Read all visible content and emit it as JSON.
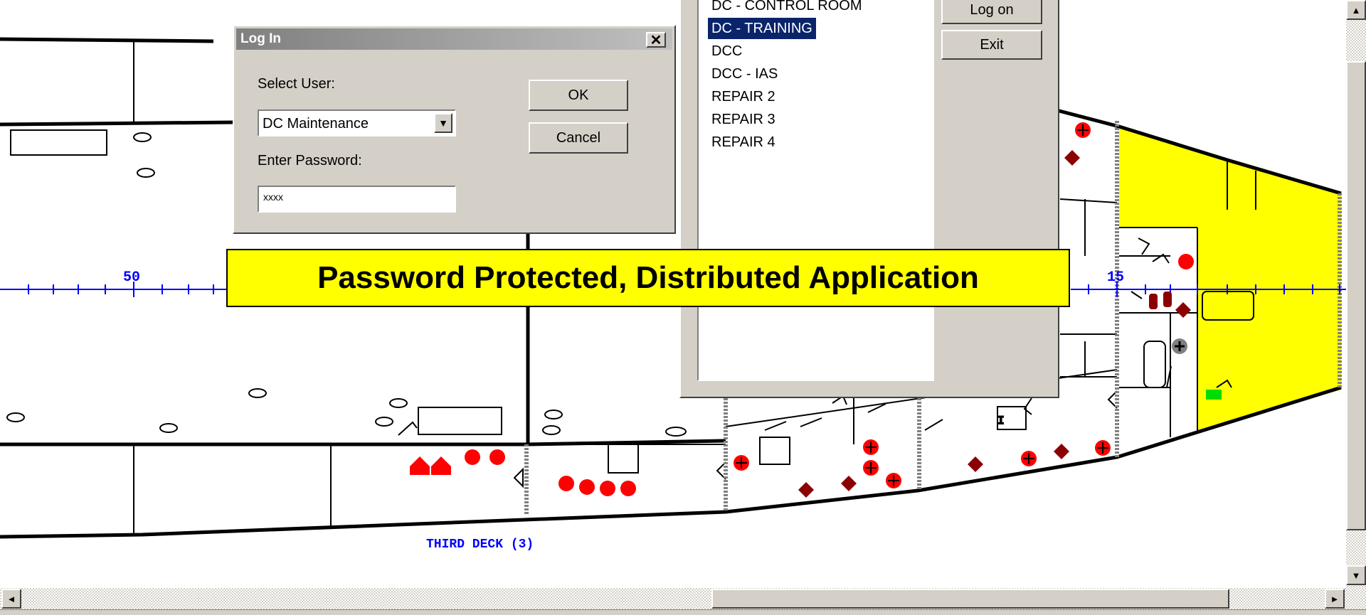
{
  "plan": {
    "frame_50": "50",
    "frame_15": "15",
    "deck_label": "THIRD DECK (3)"
  },
  "login": {
    "title": "Log In",
    "close_glyph": "✕",
    "select_user_label": "Select User:",
    "selected_user": "DC Maintenance",
    "password_label": "Enter Password:",
    "password_value": "xxxx",
    "ok_label": "OK",
    "cancel_label": "Cancel"
  },
  "station_panel": {
    "items": [
      {
        "label": "DC - CONTROL ROOM",
        "selected": false
      },
      {
        "label": "DC - TRAINING",
        "selected": true
      },
      {
        "label": "DCC",
        "selected": false
      },
      {
        "label": "DCC - IAS",
        "selected": false
      },
      {
        "label": "REPAIR 2",
        "selected": false
      },
      {
        "label": "REPAIR 3",
        "selected": false
      },
      {
        "label": "REPAIR 4",
        "selected": false
      }
    ],
    "logon_label": "Log on",
    "exit_label": "Exit"
  },
  "banner": {
    "text": "Password Protected, Distributed Application"
  },
  "scrollbars": {
    "up_arrow": "▲",
    "down_arrow": "▼",
    "left_arrow": "◄",
    "right_arrow": "►"
  },
  "colors": {
    "compartment_highlight": "#ffff00",
    "symbol_red": "#ff0000",
    "symbol_darkred": "#8b0000",
    "frame_axis": "#0000ff",
    "selection": "#0a246a",
    "dialog_face": "#d4d0c8"
  }
}
